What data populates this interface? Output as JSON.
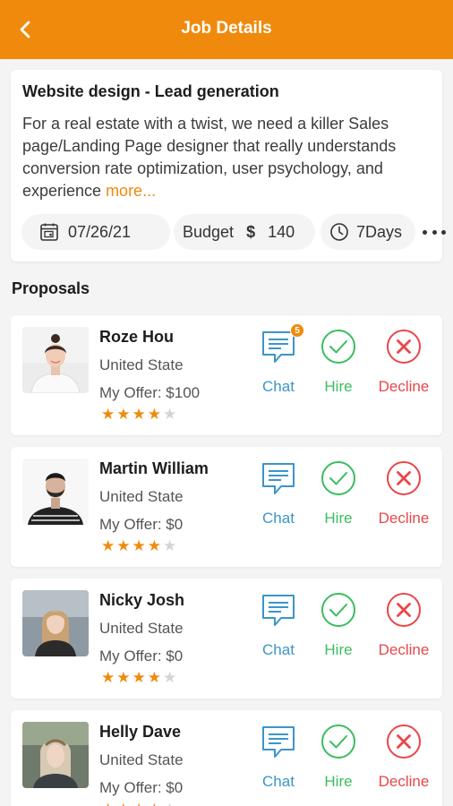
{
  "header": {
    "title": "Job Details",
    "back_icon": "chevron-left-icon"
  },
  "job": {
    "title": "Website design - Lead generation",
    "description": "For a real estate with a twist, we need a killer Sales page/Landing Page designer that really understands conversion rate optimization, user psychology, and experience ",
    "more_label": "more...",
    "date": "07/26/21",
    "budget_label": "Budget",
    "currency": "$",
    "budget_amount": "140",
    "duration": "7Days"
  },
  "proposals_title": "Proposals",
  "actions": {
    "chat": "Chat",
    "hire": "Hire",
    "decline": "Decline"
  },
  "proposals": [
    {
      "name": "Roze Hou",
      "location": "United State",
      "offer": "My Offer: $100",
      "rating": 4,
      "rating_max": 5,
      "chat_badge": "5"
    },
    {
      "name": "Martin William",
      "location": "United State",
      "offer": "My Offer: $0",
      "rating": 4,
      "rating_max": 5
    },
    {
      "name": "Nicky Josh",
      "location": "United State",
      "offer": "My Offer: $0",
      "rating": 4,
      "rating_max": 5
    },
    {
      "name": "Helly Dave",
      "location": "United State",
      "offer": "My Offer: $0",
      "rating": 4,
      "rating_max": 5
    }
  ],
  "colors": {
    "accent": "#f08a0c",
    "chat": "#3b95c9",
    "hire": "#3bbd5f",
    "decline": "#e8474a"
  }
}
